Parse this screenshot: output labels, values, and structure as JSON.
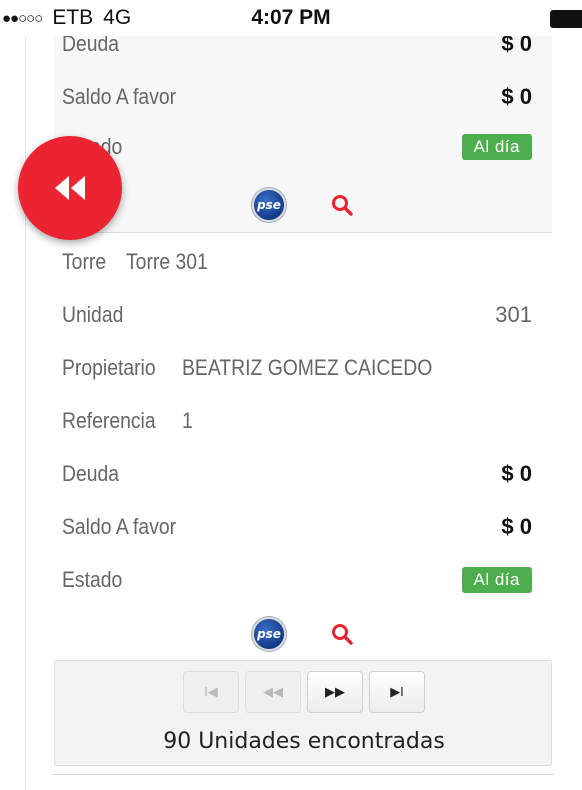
{
  "status_bar": {
    "carrier": "ETB",
    "network": "4G",
    "time": "4:07 PM"
  },
  "card1": {
    "rows": [
      {
        "label": "Deuda",
        "value": "$ 0"
      },
      {
        "label": "Saldo A favor",
        "value": "$ 0"
      },
      {
        "label": "Estado",
        "badge": "Al día"
      }
    ]
  },
  "card2": {
    "rows": [
      {
        "label": "Torre",
        "value": "Torre 301"
      },
      {
        "label": "Unidad",
        "value": "301"
      },
      {
        "label": "Propietario",
        "value": "BEATRIZ GOMEZ CAICEDO"
      },
      {
        "label": "Referencia",
        "value": "1"
      },
      {
        "label": "Deuda",
        "value": "$ 0"
      },
      {
        "label": "Saldo A favor",
        "value": "$ 0"
      },
      {
        "label": "Estado",
        "badge": "Al día"
      }
    ]
  },
  "icons": {
    "pse_text": "pse",
    "back": "rewind-icon",
    "search": "search-icon"
  },
  "pager": {
    "first": "I◀",
    "prev": "◀◀",
    "next": "▶▶",
    "last": "▶I",
    "summary": "90 Unidades encontradas"
  },
  "colors": {
    "accent_red": "#ec2330",
    "status_green": "#4cae4c"
  }
}
